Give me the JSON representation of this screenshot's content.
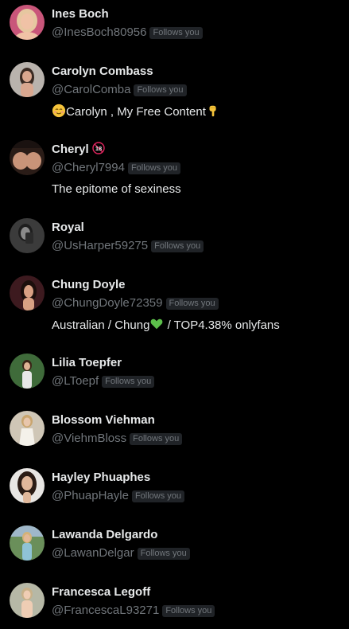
{
  "accounts": [
    {
      "name": "Ines Boch",
      "handle": "@InesBoch80956",
      "follows_label": "Follows you",
      "bio": "",
      "avatar": {
        "bg": "#c9567a",
        "skin": "#f0c2a6",
        "hair": "#e6c7a0"
      }
    },
    {
      "name": "Carolyn Combass",
      "handle": "@CarolComba",
      "follows_label": "Follows you",
      "bio_prefix_emoji": "relieved-face-emoji",
      "bio": "Carolyn , My Free Content",
      "bio_suffix_emoji": "backhand-index-pointing-down-emoji",
      "avatar": {
        "bg": "#b9b3ad",
        "skin": "#d9a78f",
        "hair": "#3a2a22"
      }
    },
    {
      "name": "Cheryl",
      "name_badge": "18",
      "handle": "@Cheryl7994",
      "follows_label": "Follows you",
      "bio": "The epitome of sexiness",
      "avatar": {
        "bg": "#2a1c17",
        "skin": "#c99479",
        "hair": "#1a1210"
      }
    },
    {
      "name": "Royal",
      "handle": "@UsHarper59275",
      "follows_label": "Follows you",
      "bio": "",
      "avatar": {
        "bg": "#3b3b3b",
        "skin": "#8a8a8a",
        "hair": "#1e1e1e"
      }
    },
    {
      "name": "Chung Doyle",
      "handle": "@ChungDoyle72359",
      "follows_label": "Follows you",
      "bio_part1": "Australian / Chung",
      "bio_heart": "green-heart-emoji",
      "bio_part2": " / TOP4.38% onlyfans",
      "avatar": {
        "bg": "#3d1a1f",
        "skin": "#d9a184",
        "hair": "#1c0f0c"
      }
    },
    {
      "name": "Lilia Toepfer",
      "handle": "@LToepf",
      "follows_label": "Follows you",
      "bio": "",
      "avatar": {
        "bg": "#3f6b3a",
        "skin": "#e0b395",
        "hair": "#3a2417"
      }
    },
    {
      "name": "Blossom Viehman",
      "handle": "@ViehmBloss",
      "follows_label": "Follows you",
      "bio": "",
      "avatar": {
        "bg": "#cfc6b6",
        "skin": "#e8c6ac",
        "hair": "#c9a56e"
      }
    },
    {
      "name": "Hayley Phuaphes",
      "handle": "@PhuapHayle",
      "follows_label": "Follows you",
      "bio": "",
      "avatar": {
        "bg": "#e8e6e3",
        "skin": "#e1b89b",
        "hair": "#2b1c15"
      }
    },
    {
      "name": "Lawanda Delgardo",
      "handle": "@LawanDelgar",
      "follows_label": "Follows you",
      "bio": "",
      "avatar": {
        "bg": "#6a8f5a",
        "skin": "#e3b898",
        "hair": "#d4b278"
      }
    },
    {
      "name": "Francesca Legoff",
      "handle": "@FrancescaL93271",
      "follows_label": "Follows you",
      "bio": "",
      "avatar": {
        "bg": "#b6b8a6",
        "skin": "#efcdb4",
        "hair": "#c8b189"
      }
    }
  ],
  "colors": {
    "background": "#000000",
    "primary_text": "#e7e9ea",
    "secondary_text": "#71767b",
    "badge_bg": "#202327",
    "green_heart": "#5cbf4a",
    "badge_red": "#e0245e"
  }
}
